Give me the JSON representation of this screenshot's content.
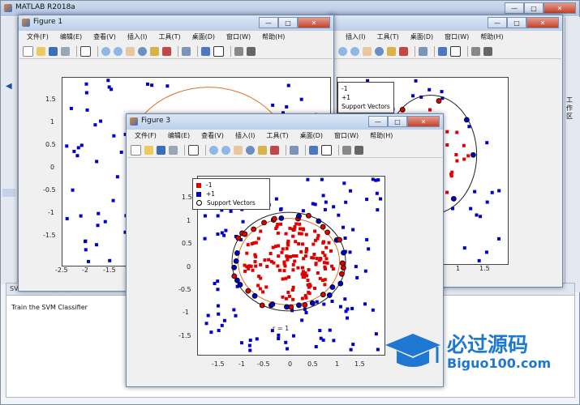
{
  "app": {
    "title": "MATLAB R2018a"
  },
  "side_tabs": {
    "work": "工作区"
  },
  "script_panel": {
    "title": "SVMdemo.m (脚本)",
    "text": "Train the SVM Classifier"
  },
  "figure_menu": [
    "文件(F)",
    "编辑(E)",
    "查看(V)",
    "插入(I)",
    "工具(T)",
    "桌面(D)",
    "窗口(W)",
    "帮助(H)"
  ],
  "window_buttons": {
    "min": "—",
    "max": "□",
    "close": "✕"
  },
  "figure1": {
    "title": "Figure 1",
    "yticks": [
      "1.5",
      "1",
      "0.5",
      "0",
      "-0.5",
      "-1",
      "-1.5"
    ],
    "xticks": [
      "-2.5",
      "-2",
      "-1.5",
      "-1"
    ]
  },
  "figure2": {
    "legend": [
      "-1",
      "+1",
      "Support Vectors"
    ],
    "xticks": [
      "1",
      "1.5"
    ]
  },
  "figure3": {
    "title": "Figure 3",
    "legend": [
      "-1",
      "+1",
      "Support Vectors"
    ],
    "yticks": [
      "1.5",
      "1",
      "0.5",
      "0",
      "-0.5",
      "-1",
      "-1.5"
    ],
    "xticks": [
      "-1.5",
      "-1",
      "-0.5",
      "0",
      "0.5",
      "1",
      "1.5"
    ],
    "annotation": "r = 1"
  },
  "watermark": {
    "cn": "必过源码",
    "en": "Biguo100.com"
  },
  "colors": {
    "neg": "#e00000",
    "pos": "#0000c8",
    "boundary": "#222222",
    "circle": "#e07020"
  }
}
